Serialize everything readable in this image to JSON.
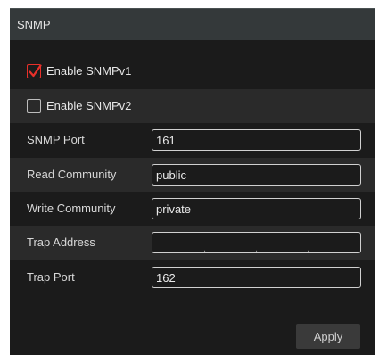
{
  "panel": {
    "title": "SNMP"
  },
  "snmp_v1": {
    "label": "Enable SNMPv1",
    "checked": true
  },
  "snmp_v2": {
    "label": "Enable SNMPv2",
    "checked": false
  },
  "fields": {
    "snmp_port": {
      "label": "SNMP Port",
      "value": "161"
    },
    "read_community": {
      "label": "Read Community",
      "value": "public"
    },
    "write_community": {
      "label": "Write Community",
      "value": "private"
    },
    "trap_address": {
      "label": "Trap Address",
      "separator": "."
    },
    "trap_port": {
      "label": "Trap Port",
      "value": "162"
    }
  },
  "actions": {
    "apply_label": "Apply"
  },
  "colors": {
    "check_mark": "#e8302a",
    "checkbox_border_checked": "#e8302a"
  },
  "icons": {
    "checkbox_checked": "checkmark-icon"
  }
}
